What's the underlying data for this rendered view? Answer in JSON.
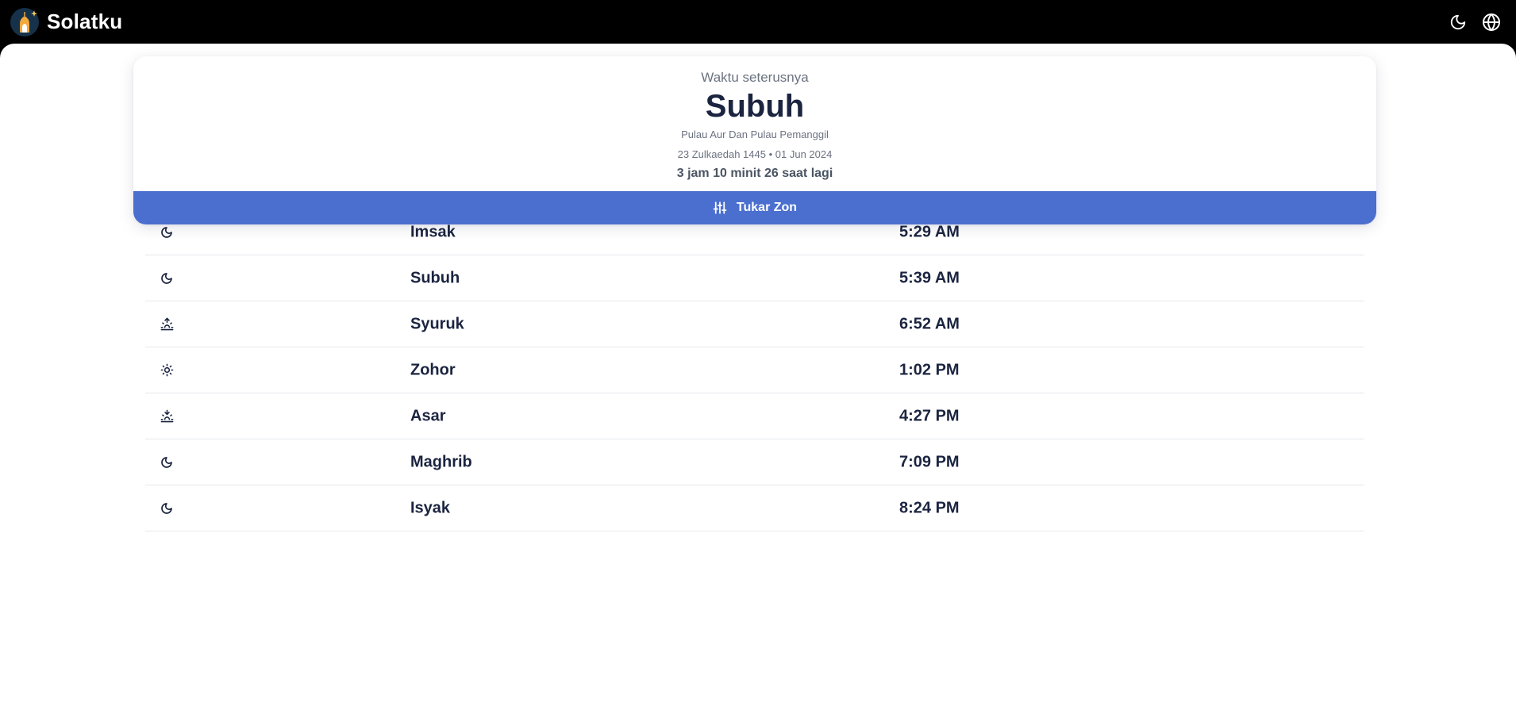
{
  "app": {
    "name": "Solatku"
  },
  "header": {
    "theme_icon": "moon-icon",
    "language_icon": "globe-icon"
  },
  "next_prayer": {
    "label": "Waktu seterusnya",
    "name": "Subuh",
    "zone": "Pulau Aur Dan Pulau Pemanggil",
    "hijri_date": "23 Zulkaedah 1445",
    "separator": "•",
    "gregorian_date": "01 Jun 2024",
    "countdown": "3 jam 10 minit 26 saat lagi",
    "change_zone_label": "Tukar Zon",
    "change_zone_icon": "sliders-icon"
  },
  "prayer_times": [
    {
      "icon": "moon-icon",
      "name": "Imsak",
      "time": "5:29 AM"
    },
    {
      "icon": "moon-icon",
      "name": "Subuh",
      "time": "5:39 AM"
    },
    {
      "icon": "sunrise-icon",
      "name": "Syuruk",
      "time": "6:52 AM"
    },
    {
      "icon": "sun-icon",
      "name": "Zohor",
      "time": "1:02 PM"
    },
    {
      "icon": "sunset-icon",
      "name": "Asar",
      "time": "4:27 PM"
    },
    {
      "icon": "moon-icon",
      "name": "Maghrib",
      "time": "7:09 PM"
    },
    {
      "icon": "moon-icon",
      "name": "Isyak",
      "time": "8:24 PM"
    }
  ],
  "colors": {
    "accent": "#4b6fcf",
    "text_primary": "#1b2440",
    "text_muted": "#6b7280",
    "topbar": "#000000"
  }
}
